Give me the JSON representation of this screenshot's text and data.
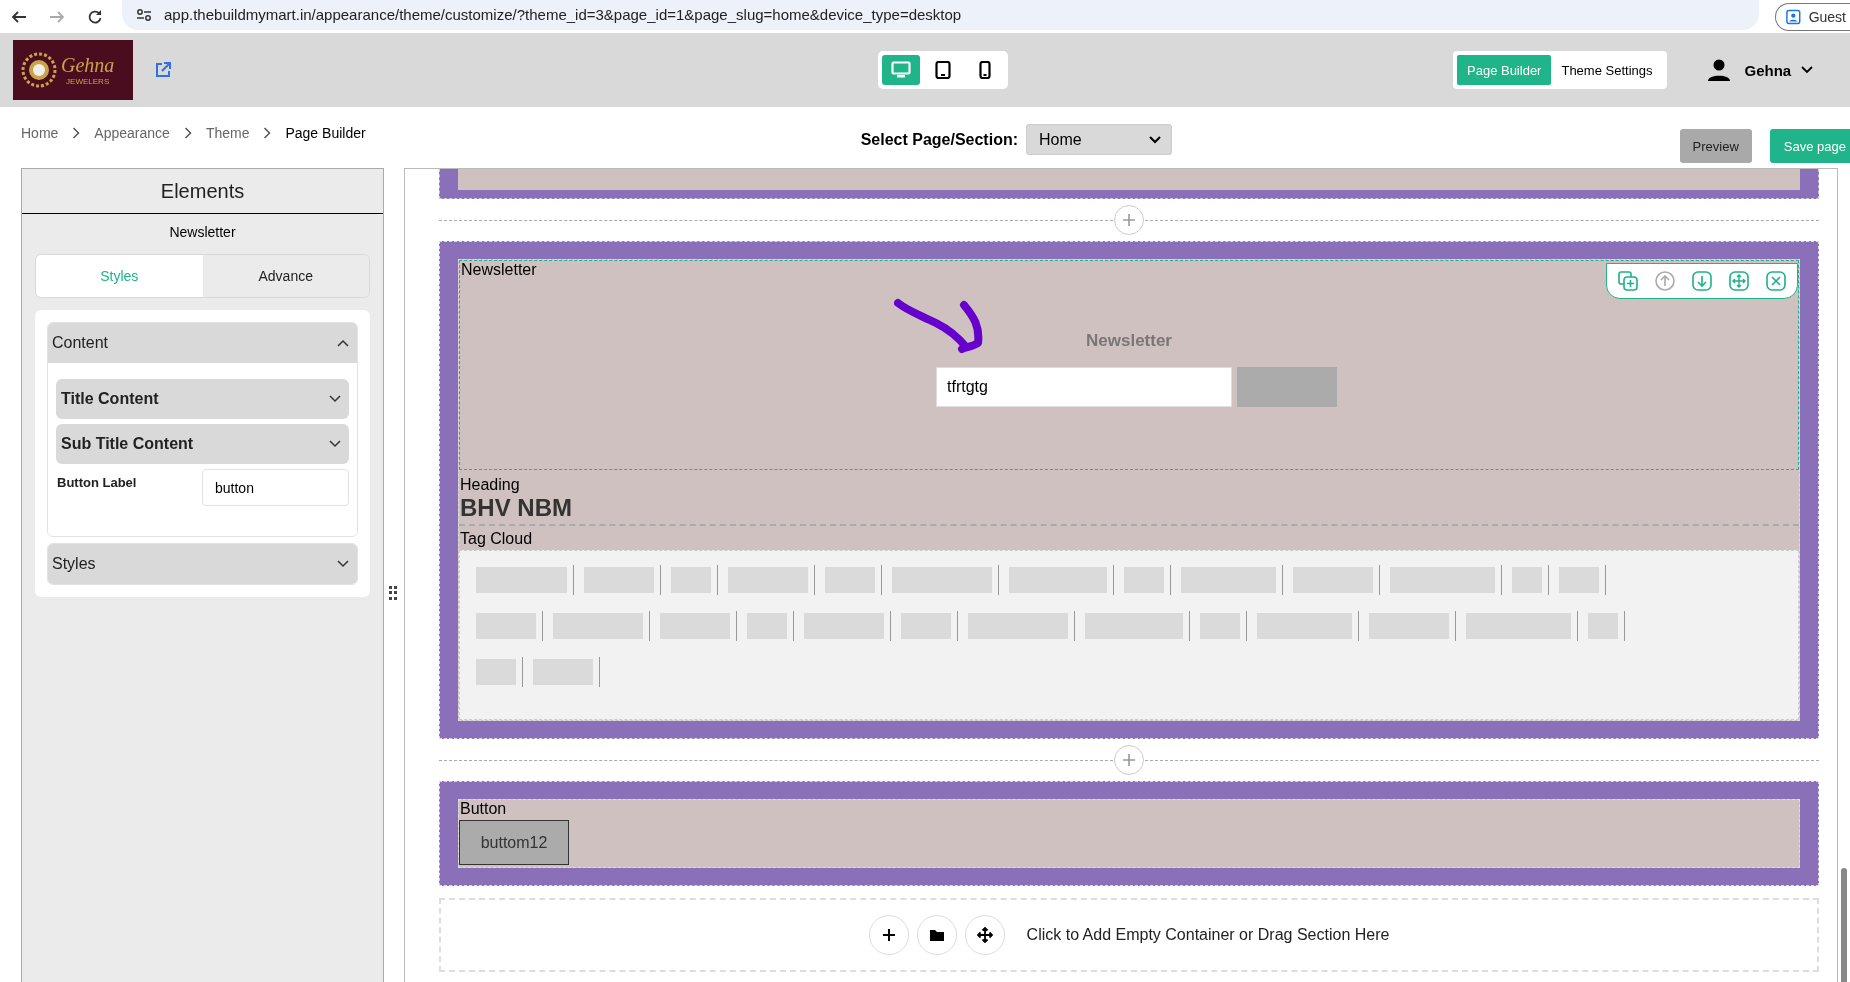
{
  "browser": {
    "url": "app.thebuildmymart.in/appearance/theme/customize/?theme_id=3&page_id=1&page_slug=home&device_type=desktop",
    "profile": "Guest"
  },
  "header": {
    "logo_text": "Gehna",
    "logo_sub": "JEWELERS",
    "devices": [
      {
        "kind": "desktop",
        "selected": true
      },
      {
        "kind": "tablet",
        "selected": false
      },
      {
        "kind": "mobile",
        "selected": false
      }
    ],
    "modes": [
      {
        "label": "Page Builder",
        "selected": true
      },
      {
        "label": "Theme Settings",
        "selected": false
      }
    ],
    "user": "Gehna"
  },
  "breadcrumb": [
    "Home",
    "Appearance",
    "Theme",
    "Page Builder"
  ],
  "page_select": {
    "label": "Select Page/Section:",
    "value": "Home"
  },
  "actions": [
    {
      "label": "Preview",
      "kind": "secondary"
    },
    {
      "label": "Save page",
      "kind": "primary"
    }
  ],
  "sidebar": {
    "title": "Elements",
    "element": "Newsletter",
    "tabs": [
      {
        "label": "Styles",
        "selected": true
      },
      {
        "label": "Advance",
        "selected": false
      }
    ],
    "groups": [
      {
        "label": "Content",
        "expanded": true,
        "children": [
          {
            "kind": "accordion",
            "label": "Title Content",
            "expanded": false
          },
          {
            "kind": "accordion",
            "label": "Sub Title Content",
            "expanded": false
          },
          {
            "kind": "field",
            "label": "Button Label",
            "value": "button"
          }
        ]
      },
      {
        "label": "Styles",
        "expanded": false
      }
    ]
  },
  "canvas": {
    "sections": [
      {
        "blocks": [
          {
            "kind": "newsletter",
            "label": "Newsletter",
            "selected": true,
            "title": "Newsletter",
            "value": "tfrtgtg"
          },
          {
            "kind": "heading",
            "label": "Heading",
            "selected": false,
            "text": "BHV NBM"
          },
          {
            "kind": "tagcloud",
            "label": "Tag Cloud",
            "selected": false
          }
        ]
      },
      {
        "blocks": [
          {
            "kind": "button",
            "label": "Button",
            "selected": false,
            "button": "buttom12"
          }
        ]
      }
    ],
    "add_container": "Click to Add Empty Container or Drag Section Here"
  }
}
